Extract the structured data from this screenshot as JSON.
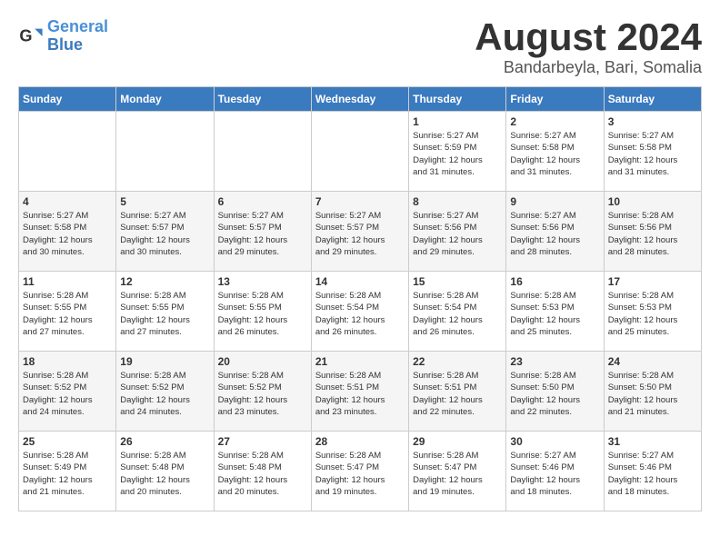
{
  "app": {
    "name": "GeneralBlue",
    "logo_symbol": "🔵"
  },
  "header": {
    "month_title": "August 2024",
    "location": "Bandarbeyla, Bari, Somalia"
  },
  "days_of_week": [
    "Sunday",
    "Monday",
    "Tuesday",
    "Wednesday",
    "Thursday",
    "Friday",
    "Saturday"
  ],
  "weeks": [
    [
      {
        "day": "",
        "info": ""
      },
      {
        "day": "",
        "info": ""
      },
      {
        "day": "",
        "info": ""
      },
      {
        "day": "",
        "info": ""
      },
      {
        "day": "1",
        "info": "Sunrise: 5:27 AM\nSunset: 5:59 PM\nDaylight: 12 hours\nand 31 minutes."
      },
      {
        "day": "2",
        "info": "Sunrise: 5:27 AM\nSunset: 5:58 PM\nDaylight: 12 hours\nand 31 minutes."
      },
      {
        "day": "3",
        "info": "Sunrise: 5:27 AM\nSunset: 5:58 PM\nDaylight: 12 hours\nand 31 minutes."
      }
    ],
    [
      {
        "day": "4",
        "info": "Sunrise: 5:27 AM\nSunset: 5:58 PM\nDaylight: 12 hours\nand 30 minutes."
      },
      {
        "day": "5",
        "info": "Sunrise: 5:27 AM\nSunset: 5:57 PM\nDaylight: 12 hours\nand 30 minutes."
      },
      {
        "day": "6",
        "info": "Sunrise: 5:27 AM\nSunset: 5:57 PM\nDaylight: 12 hours\nand 29 minutes."
      },
      {
        "day": "7",
        "info": "Sunrise: 5:27 AM\nSunset: 5:57 PM\nDaylight: 12 hours\nand 29 minutes."
      },
      {
        "day": "8",
        "info": "Sunrise: 5:27 AM\nSunset: 5:56 PM\nDaylight: 12 hours\nand 29 minutes."
      },
      {
        "day": "9",
        "info": "Sunrise: 5:27 AM\nSunset: 5:56 PM\nDaylight: 12 hours\nand 28 minutes."
      },
      {
        "day": "10",
        "info": "Sunrise: 5:28 AM\nSunset: 5:56 PM\nDaylight: 12 hours\nand 28 minutes."
      }
    ],
    [
      {
        "day": "11",
        "info": "Sunrise: 5:28 AM\nSunset: 5:55 PM\nDaylight: 12 hours\nand 27 minutes."
      },
      {
        "day": "12",
        "info": "Sunrise: 5:28 AM\nSunset: 5:55 PM\nDaylight: 12 hours\nand 27 minutes."
      },
      {
        "day": "13",
        "info": "Sunrise: 5:28 AM\nSunset: 5:55 PM\nDaylight: 12 hours\nand 26 minutes."
      },
      {
        "day": "14",
        "info": "Sunrise: 5:28 AM\nSunset: 5:54 PM\nDaylight: 12 hours\nand 26 minutes."
      },
      {
        "day": "15",
        "info": "Sunrise: 5:28 AM\nSunset: 5:54 PM\nDaylight: 12 hours\nand 26 minutes."
      },
      {
        "day": "16",
        "info": "Sunrise: 5:28 AM\nSunset: 5:53 PM\nDaylight: 12 hours\nand 25 minutes."
      },
      {
        "day": "17",
        "info": "Sunrise: 5:28 AM\nSunset: 5:53 PM\nDaylight: 12 hours\nand 25 minutes."
      }
    ],
    [
      {
        "day": "18",
        "info": "Sunrise: 5:28 AM\nSunset: 5:52 PM\nDaylight: 12 hours\nand 24 minutes."
      },
      {
        "day": "19",
        "info": "Sunrise: 5:28 AM\nSunset: 5:52 PM\nDaylight: 12 hours\nand 24 minutes."
      },
      {
        "day": "20",
        "info": "Sunrise: 5:28 AM\nSunset: 5:52 PM\nDaylight: 12 hours\nand 23 minutes."
      },
      {
        "day": "21",
        "info": "Sunrise: 5:28 AM\nSunset: 5:51 PM\nDaylight: 12 hours\nand 23 minutes."
      },
      {
        "day": "22",
        "info": "Sunrise: 5:28 AM\nSunset: 5:51 PM\nDaylight: 12 hours\nand 22 minutes."
      },
      {
        "day": "23",
        "info": "Sunrise: 5:28 AM\nSunset: 5:50 PM\nDaylight: 12 hours\nand 22 minutes."
      },
      {
        "day": "24",
        "info": "Sunrise: 5:28 AM\nSunset: 5:50 PM\nDaylight: 12 hours\nand 21 minutes."
      }
    ],
    [
      {
        "day": "25",
        "info": "Sunrise: 5:28 AM\nSunset: 5:49 PM\nDaylight: 12 hours\nand 21 minutes."
      },
      {
        "day": "26",
        "info": "Sunrise: 5:28 AM\nSunset: 5:48 PM\nDaylight: 12 hours\nand 20 minutes."
      },
      {
        "day": "27",
        "info": "Sunrise: 5:28 AM\nSunset: 5:48 PM\nDaylight: 12 hours\nand 20 minutes."
      },
      {
        "day": "28",
        "info": "Sunrise: 5:28 AM\nSunset: 5:47 PM\nDaylight: 12 hours\nand 19 minutes."
      },
      {
        "day": "29",
        "info": "Sunrise: 5:28 AM\nSunset: 5:47 PM\nDaylight: 12 hours\nand 19 minutes."
      },
      {
        "day": "30",
        "info": "Sunrise: 5:27 AM\nSunset: 5:46 PM\nDaylight: 12 hours\nand 18 minutes."
      },
      {
        "day": "31",
        "info": "Sunrise: 5:27 AM\nSunset: 5:46 PM\nDaylight: 12 hours\nand 18 minutes."
      }
    ]
  ]
}
